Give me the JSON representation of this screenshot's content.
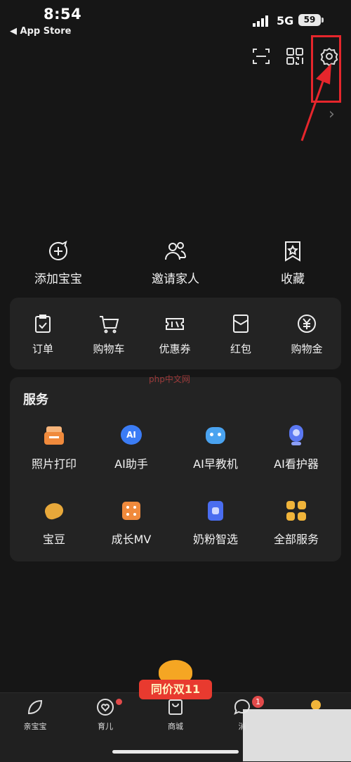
{
  "status": {
    "time": "8:54",
    "back_label": "◀ App Store",
    "network": "5G",
    "battery": "59"
  },
  "quick_actions": [
    {
      "label": "添加宝宝",
      "icon": "add-baby-icon"
    },
    {
      "label": "邀请家人",
      "icon": "invite-family-icon"
    },
    {
      "label": "收藏",
      "icon": "favorite-icon"
    }
  ],
  "orders": [
    {
      "label": "订单",
      "icon": "order-icon"
    },
    {
      "label": "购物车",
      "icon": "cart-icon"
    },
    {
      "label": "优惠券",
      "icon": "coupon-icon"
    },
    {
      "label": "红包",
      "icon": "red-packet-icon"
    },
    {
      "label": "购物金",
      "icon": "shopping-gold-icon"
    }
  ],
  "services": {
    "title": "服务",
    "items": [
      {
        "label": "照片打印",
        "color": "#f08a3c"
      },
      {
        "label": "AI助手",
        "color": "#3b7cf5"
      },
      {
        "label": "AI早教机",
        "color": "#4aa3f0"
      },
      {
        "label": "AI看护器",
        "color": "#5b78f2"
      },
      {
        "label": "宝豆",
        "color": "#e8a83a"
      },
      {
        "label": "成长MV",
        "color": "#f08a3c"
      },
      {
        "label": "奶粉智选",
        "color": "#4a6df0"
      },
      {
        "label": "全部服务",
        "color": "#f0b43a"
      }
    ]
  },
  "watermark": "php中文网",
  "promo_label": "同价双11",
  "tabs": [
    {
      "label": "亲宝宝"
    },
    {
      "label": "育儿"
    },
    {
      "label": "商城"
    },
    {
      "label": "消"
    }
  ],
  "message_badge": "1"
}
